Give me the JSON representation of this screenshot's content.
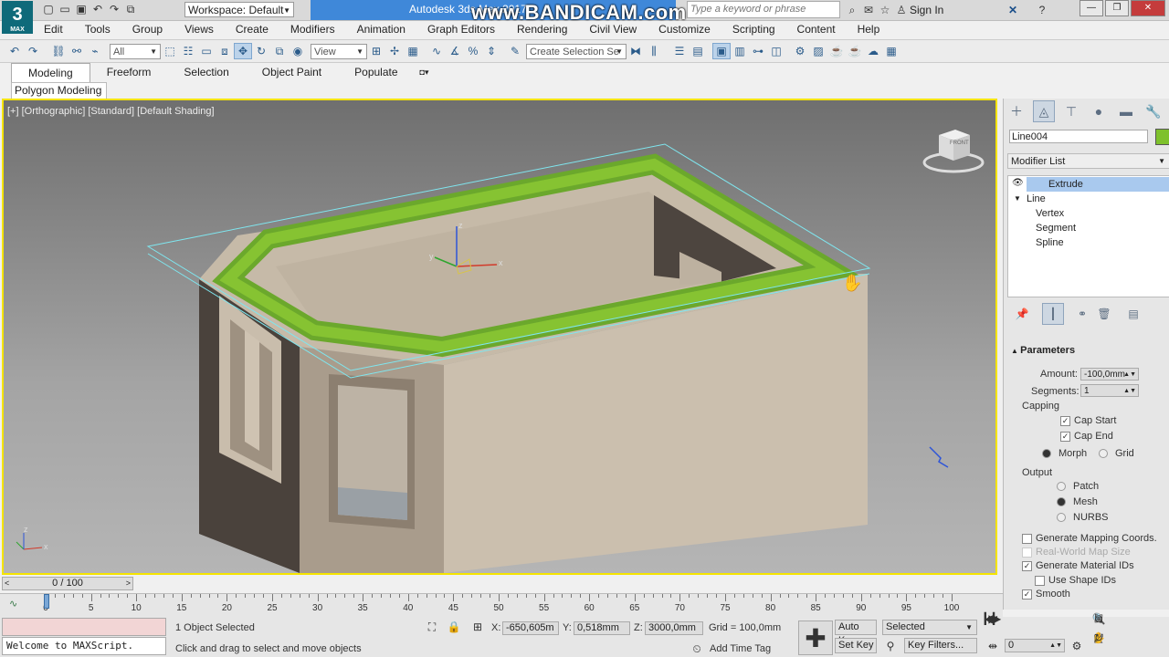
{
  "app": {
    "logo_text": "3",
    "logo_sub": "MAX",
    "workspace": "Workspace: Default",
    "title": "Autodesk 3ds Max 2017",
    "watermark": "www.BANDICAM.com",
    "search_placeholder": "Type a keyword or phrase",
    "sign_in": "Sign In"
  },
  "menu": [
    "Edit",
    "Tools",
    "Group",
    "Views",
    "Create",
    "Modifiers",
    "Animation",
    "Graph Editors",
    "Rendering",
    "Civil View",
    "Customize",
    "Scripting",
    "Content",
    "Help"
  ],
  "toolbar": {
    "filter": "All",
    "ref_coord": "View",
    "selection_set": "Create Selection Se"
  },
  "ribbon": {
    "tabs": [
      "Modeling",
      "Freeform",
      "Selection",
      "Object Paint",
      "Populate"
    ],
    "panel": "Polygon Modeling"
  },
  "viewport": {
    "label": "[+] [Orthographic] [Standard] [Default Shading]",
    "viewcube_face": "FRONT",
    "axes": [
      "x",
      "y",
      "z"
    ]
  },
  "command_panel": {
    "object_name": "Line004",
    "object_color": "#7ec12c",
    "modifier_list": "Modifier List",
    "stack": [
      "Extrude",
      "Line",
      "Vertex",
      "Segment",
      "Spline"
    ],
    "rollout": "Parameters",
    "amount_label": "Amount:",
    "amount": "-100,0mm",
    "segments_label": "Segments:",
    "segments": "1",
    "capping_label": "Capping",
    "cap_start": "Cap Start",
    "cap_end": "Cap End",
    "morph": "Morph",
    "grid": "Grid",
    "output_label": "Output",
    "patch": "Patch",
    "mesh": "Mesh",
    "nurbs": "NURBS",
    "gen_mapping": "Generate Mapping Coords.",
    "real_world": "Real-World Map Size",
    "gen_material": "Generate Material IDs",
    "use_shape": "Use Shape IDs",
    "smooth": "Smooth"
  },
  "timeline": {
    "slider": "0 / 100",
    "ticks": [
      "0",
      "5",
      "10",
      "15",
      "20",
      "25",
      "30",
      "35",
      "40",
      "45",
      "50",
      "55",
      "60",
      "65",
      "70",
      "75",
      "80",
      "85",
      "90",
      "95",
      "100"
    ]
  },
  "status": {
    "maxscript": "Welcome to MAXScript.",
    "selected": "1 Object Selected",
    "prompt": "Click and drag to select and move objects",
    "x_label": "X:",
    "x": "-650,605m",
    "y_label": "Y:",
    "y": "0,518mm",
    "z_label": "Z:",
    "z": "3000,0mm",
    "grid": "Grid = 100,0mm",
    "add_time_tag": "Add Time Tag",
    "auto_key": "Auto Key",
    "set_key": "Set Key",
    "key_mode": "Selected",
    "key_filters": "Key Filters...",
    "frame": "0"
  }
}
